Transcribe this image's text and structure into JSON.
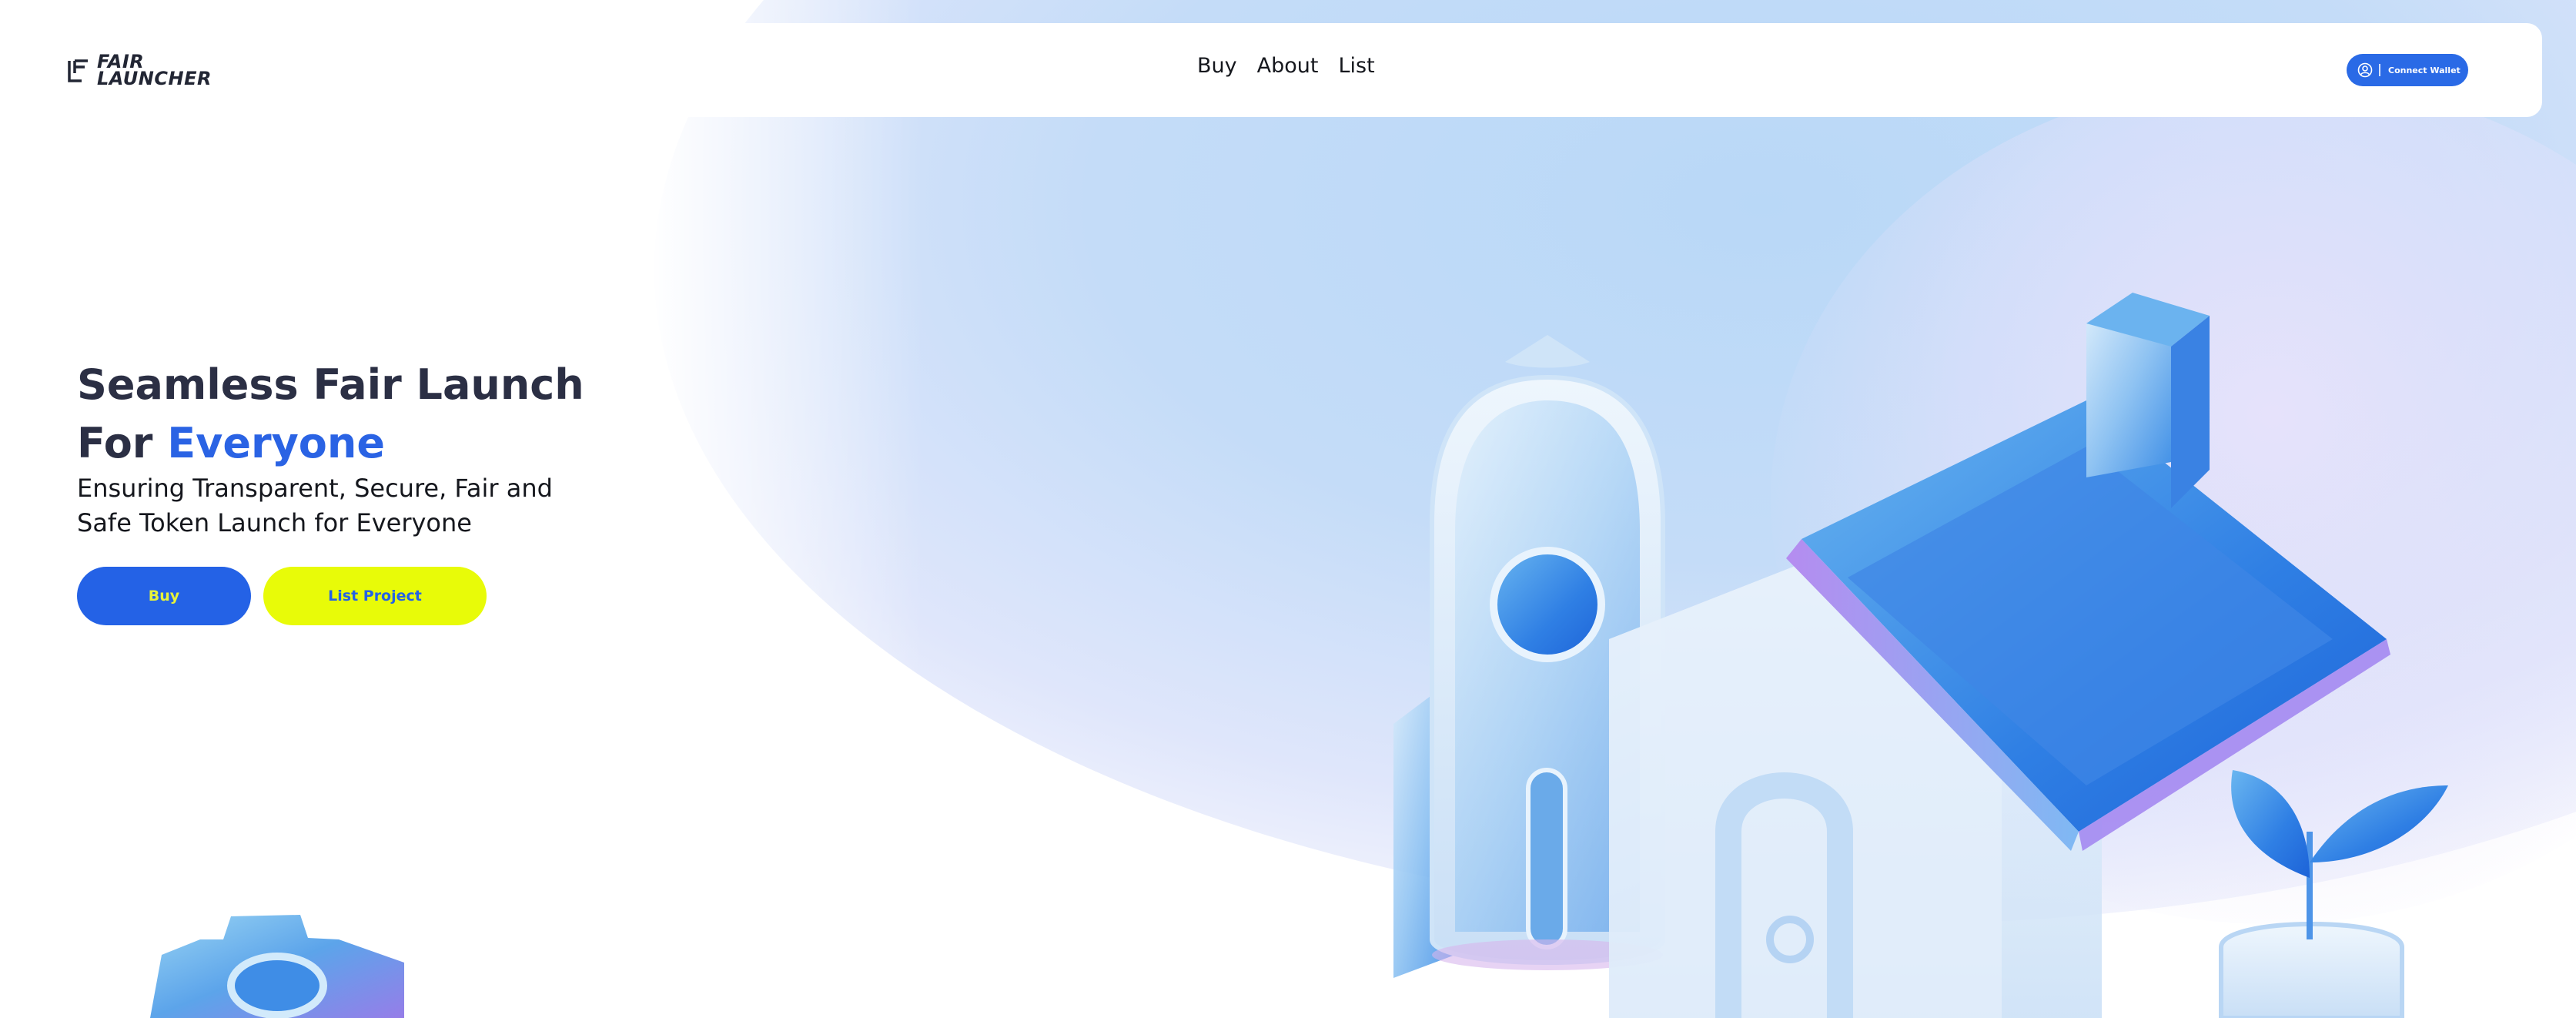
{
  "header": {
    "logo_line1": "FAIR",
    "logo_line2": "LAUNCHER",
    "nav": [
      {
        "label": "Buy"
      },
      {
        "label": "About"
      },
      {
        "label": "List"
      }
    ],
    "wallet_button": {
      "label": "Connect Wallet",
      "icon": "user-circle-icon"
    }
  },
  "hero": {
    "title_line1": "Seamless Fair Launch",
    "title_line2_prefix": "For",
    "title_line2_accent": "Everyone",
    "subtitle": "Ensuring Transparent, Secure, Fair and Safe Token Launch for Everyone",
    "buy_label": "Buy",
    "list_label": "List Project"
  },
  "colors": {
    "brand_blue": "#2462e6",
    "brand_yellow": "#e8fb08",
    "title_dark": "#2b2f44"
  },
  "illustrations": [
    "rocket-illustration",
    "house-illustration",
    "plant-illustration",
    "gear-illustration"
  ]
}
